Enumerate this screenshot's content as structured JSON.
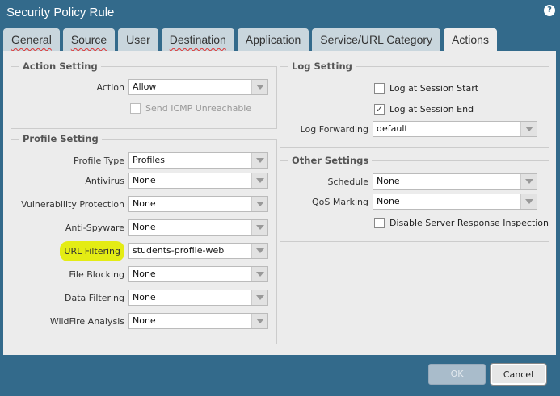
{
  "title": "Security Policy Rule",
  "tabs": [
    {
      "label": "General",
      "error": true
    },
    {
      "label": "Source",
      "error": true
    },
    {
      "label": "User",
      "error": false
    },
    {
      "label": "Destination",
      "error": true
    },
    {
      "label": "Application",
      "error": false
    },
    {
      "label": "Service/URL Category",
      "error": false
    },
    {
      "label": "Actions",
      "error": false,
      "active": true
    }
  ],
  "action_setting": {
    "legend": "Action Setting",
    "action_label": "Action",
    "action_value": "Allow",
    "icmp_label": "Send ICMP Unreachable",
    "icmp_checked": false
  },
  "profile_setting": {
    "legend": "Profile Setting",
    "rows": [
      {
        "label": "Profile Type",
        "value": "Profiles"
      },
      {
        "label": "Antivirus",
        "value": "None"
      },
      {
        "label": "Vulnerability Protection",
        "value": "None"
      },
      {
        "label": "Anti-Spyware",
        "value": "None"
      },
      {
        "label": "URL Filtering",
        "value": "students-profile-web",
        "highlighted": true
      },
      {
        "label": "File Blocking",
        "value": "None"
      },
      {
        "label": "Data Filtering",
        "value": "None"
      },
      {
        "label": "WildFire Analysis",
        "value": "None"
      }
    ]
  },
  "log_setting": {
    "legend": "Log Setting",
    "start_label": "Log at Session Start",
    "start_checked": false,
    "end_label": "Log at Session End",
    "end_checked": true,
    "forwarding_label": "Log Forwarding",
    "forwarding_value": "default"
  },
  "other_settings": {
    "legend": "Other Settings",
    "schedule_label": "Schedule",
    "schedule_value": "None",
    "qos_label": "QoS Marking",
    "qos_value": "None",
    "disable_label": "Disable Server Response Inspection",
    "disable_checked": false
  },
  "buttons": {
    "ok": "OK",
    "cancel": "Cancel"
  },
  "check_mark": "✓"
}
